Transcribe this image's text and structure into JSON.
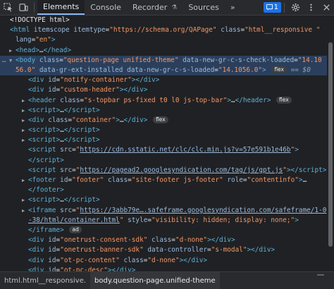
{
  "toolbar": {
    "tabs": [
      {
        "label": "Elements",
        "active": true
      },
      {
        "label": "Console"
      },
      {
        "label": "Recorder"
      },
      {
        "label": "Sources"
      }
    ],
    "more_tabs_icon": "chevron-double-right-icon",
    "issues_count": "1",
    "icons": [
      "cursor-select-icon",
      "device-toggle-icon",
      "gear-icon",
      "more-vertical-icon",
      "close-icon"
    ]
  },
  "elements_tree": {
    "rows": [
      {
        "html": "<span class='txt'>&lt;!DOCTYPE html&gt;</span>"
      },
      {
        "html": "<span class='tag'>&lt;html</span> <span class='attr'>itemscope</span> <span class='attr'>itemtype</span><span class='txt'>=</span><span class='val'>\"https://schema.org/QAPage\"</span> <span class='attr'>class</span><span class='txt'>=</span><span class='val'>\"html__responsive \"</span>"
      },
      {
        "html": "<span class='attr'>lang</span><span class='txt'>=</span><span class='val'>\"en\"</span><span class='tag'>&gt;</span>"
      },
      {
        "html": "<span class='tag'>&lt;head&gt;</span><span class='txt'>…</span><span class='tag'>&lt;/head&gt;</span>"
      },
      {
        "html": "<span class='tag'>&lt;body</span> <span class='attr'>class</span><span class='txt'>=</span><span class='val'>\"question-page unified-theme\"</span> <span class='attr'>data-new-gr-c-s-check-loaded</span><span class='txt'>=</span><span class='val'>\"14.10</span>"
      },
      {
        "html": "<span class='val'>56.0\"</span> <span class='attr'>data-gr-ext-installed</span> <span class='attr'>data-new-gr-c-s-loaded</span><span class='txt'>=</span><span class='val'>\"14.1056.0\"</span><span class='tag'>&gt;</span>"
      },
      {
        "html": "<span class='tag'>&lt;div</span> <span class='attr'>id</span><span class='txt'>=</span><span class='val'>\"notify-container\"</span><span class='tag'>&gt;&lt;/div&gt;</span>"
      },
      {
        "html": "<span class='tag'>&lt;div</span> <span class='attr'>id</span><span class='txt'>=</span><span class='val'>\"custom-header\"</span><span class='tag'>&gt;&lt;/div&gt;</span>"
      },
      {
        "html": "<span class='tag'>&lt;header</span> <span class='attr'>class</span><span class='txt'>=</span><span class='val'>\"s-topbar ps-fixed t0 l0 js-top-bar\"</span><span class='tag'>&gt;</span><span class='txt'>…</span><span class='tag'>&lt;/header&gt;</span>"
      },
      {
        "html": "<span class='tag'>&lt;script&gt;</span><span class='txt'>…</span><span class='tag'>&lt;/script&gt;</span>"
      },
      {
        "html": "<span class='tag'>&lt;div</span> <span class='attr'>class</span><span class='txt'>=</span><span class='val'>\"container\"</span><span class='tag'>&gt;</span><span class='txt'>…</span><span class='tag'>&lt;/div&gt;</span>"
      },
      {
        "html": "<span class='tag'>&lt;script&gt;</span><span class='txt'>…</span><span class='tag'>&lt;/script&gt;</span>"
      },
      {
        "html": "<span class='tag'>&lt;script&gt;</span><span class='txt'>…</span><span class='tag'>&lt;/script&gt;</span>"
      },
      {
        "html": "<span class='tag'>&lt;script</span> <span class='attr'>src</span><span class='txt'>=</span><span class='val'>\"</span><span class='link'>https://cdn.sstatic.net/clc/clc.min.js?v=57e591b1e46b</span><span class='val'>\"</span><span class='tag'>&gt;</span>"
      },
      {
        "html": "<span class='tag'>&lt;/script&gt;</span>"
      },
      {
        "html": "<span class='tag'>&lt;script</span> <span class='attr'>src</span><span class='txt'>=</span><span class='val'>\"</span><span class='link'>https://pagead2.googlesyndication.com/tag/js/gpt.js</span><span class='val'>\"</span><span class='tag'>&gt;&lt;/script&gt;</span>"
      },
      {
        "html": "<span class='tag'>&lt;footer</span> <span class='attr'>id</span><span class='txt'>=</span><span class='val'>\"footer\"</span> <span class='attr'>class</span><span class='txt'>=</span><span class='val'>\"site-footer js-footer\"</span> <span class='attr'>role</span><span class='txt'>=</span><span class='val'>\"contentinfo\"</span><span class='tag'>&gt;</span><span class='txt'>…</span>"
      },
      {
        "html": "<span class='tag'>&lt;/footer&gt;</span>"
      },
      {
        "html": "<span class='tag'>&lt;script&gt;</span><span class='txt'>…</span><span class='tag'>&lt;/script&gt;</span>"
      },
      {
        "html": "<span class='tag'>&lt;iframe</span> <span class='attr'>src</span><span class='txt'>=</span><span class='val'>\"</span><span class='link'>https://3abb79e….safeframe.googlesyndication.com/safeframe/1-0</span>"
      },
      {
        "html": "<span class='link'>-38/html/container.html</span><span class='val'>\"</span> <span class='attr'>style</span><span class='txt'>=</span><span class='val'>\"visibility: hidden; display: none;\"</span><span class='tag'>&gt;</span>"
      },
      {
        "html": "<span class='tag'>&lt;/iframe&gt;</span>"
      },
      {
        "html": "<span class='tag'>&lt;div</span> <span class='attr'>id</span><span class='txt'>=</span><span class='val'>\"onetrust-consent-sdk\"</span> <span class='attr'>class</span><span class='txt'>=</span><span class='val'>\"d-none\"</span><span class='tag'>&gt;&lt;/div&gt;</span>"
      },
      {
        "html": "<span class='tag'>&lt;div</span> <span class='attr'>id</span><span class='txt'>=</span><span class='val'>\"onetrust-banner-sdk\"</span> <span class='attr'>data-controller</span><span class='txt'>=</span><span class='val'>\"s-modal\"</span><span class='tag'>&gt;&lt;/div&gt;</span>"
      },
      {
        "html": "<span class='tag'>&lt;div</span> <span class='attr'>id</span><span class='txt'>=</span><span class='val'>\"ot-pc-content\"</span> <span class='attr'>class</span><span class='txt'>=</span><span class='val'>\"d-none\"</span><span class='tag'>&gt;&lt;/div&gt;</span>"
      },
      {
        "html": "<span class='tag'>&lt;div</span> <span class='attr'>id</span><span class='txt'>=</span><span class='val'>\"ot-pc-desc\"</span><span class='tag'>&gt;&lt;/div&gt;</span>"
      }
    ],
    "pills": {
      "flex": "flex",
      "ad": "ad"
    },
    "selected_suffix": "== $0"
  },
  "breadcrumbs": [
    {
      "label": "html.html__responsive."
    },
    {
      "label": "body.question-page.unified-theme",
      "active": true
    }
  ],
  "colors": {
    "background": "#202124",
    "tag": "#5db0d7",
    "attr_name": "#9bbbdc",
    "attr_value": "#f29766",
    "selection": "#2b3f5c",
    "accent": "#8ab4f8"
  }
}
